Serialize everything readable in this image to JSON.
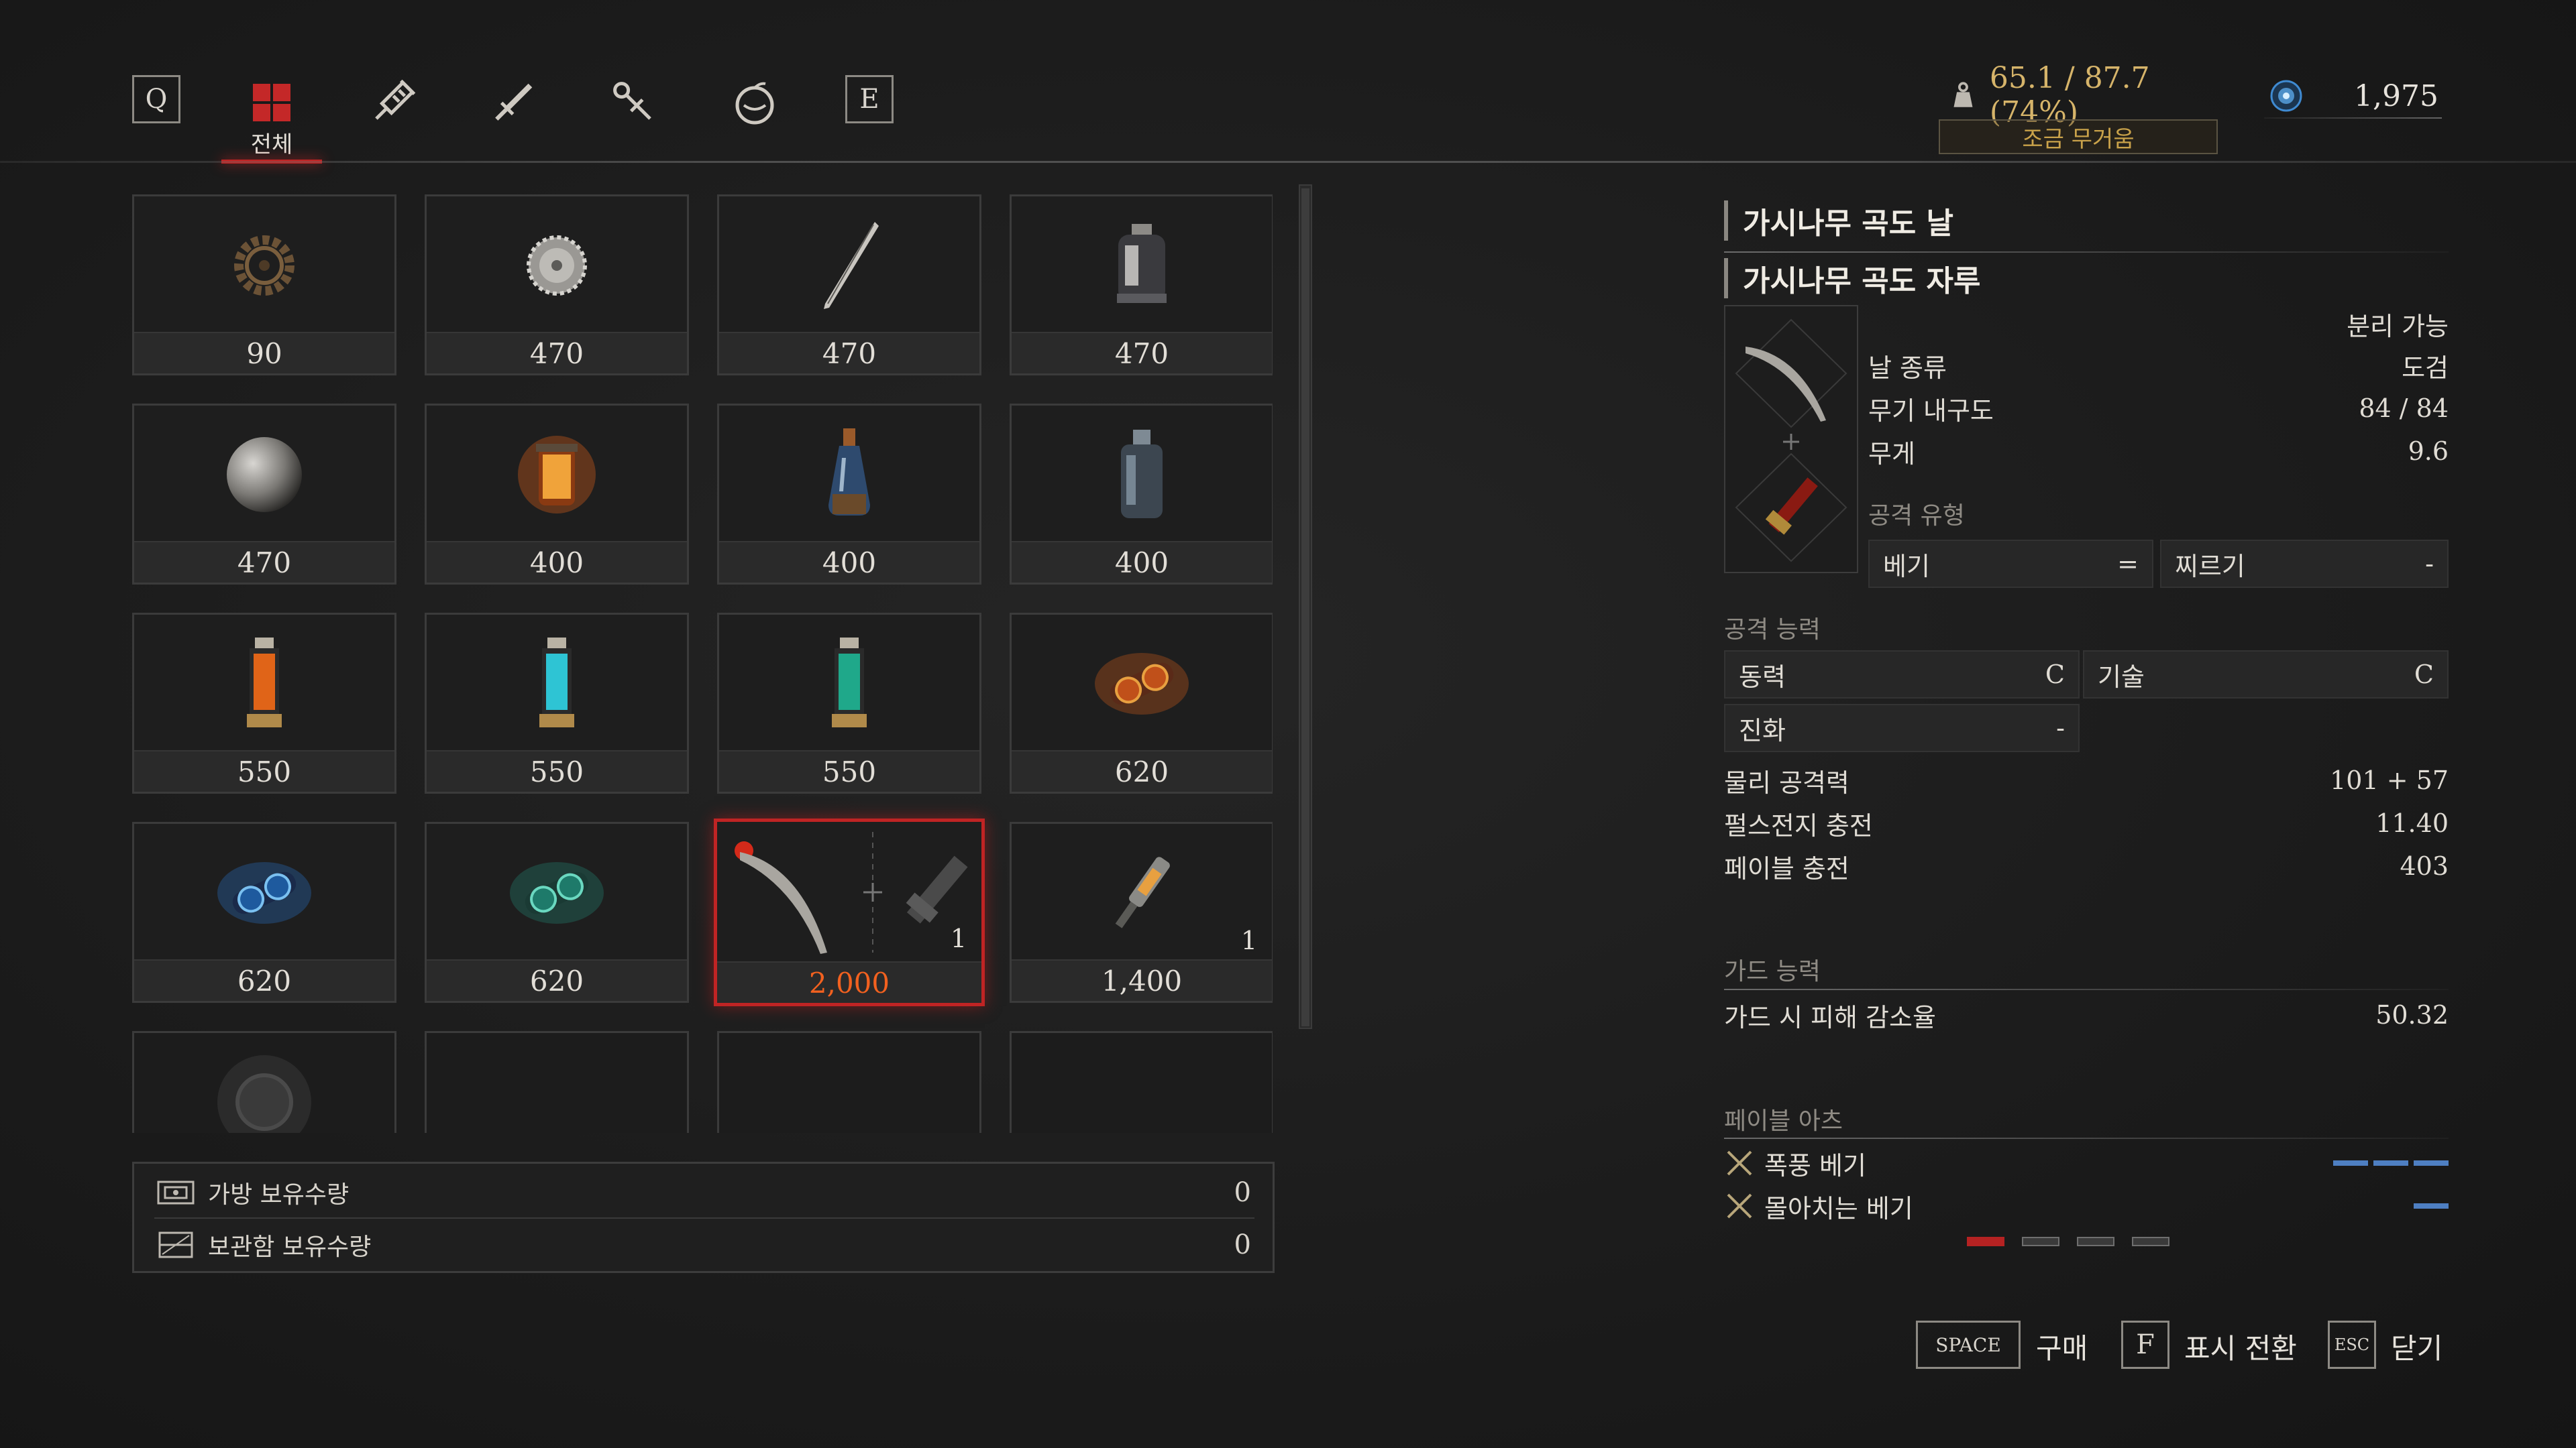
{
  "top_tabs": {
    "prev_key": "Q",
    "next_key": "E",
    "active_label": "전체",
    "icons": [
      "grid-icon",
      "syringe-icon",
      "dagger-icon",
      "wrench-icon",
      "orb-icon"
    ]
  },
  "weight": {
    "value": "65.1 / 87.7 (74%)",
    "status": "조금 무거움"
  },
  "currency": {
    "amount": "1,975"
  },
  "items": [
    {
      "price": "90",
      "icon": "gear-icon"
    },
    {
      "price": "470",
      "icon": "saw-blade-icon"
    },
    {
      "price": "470",
      "icon": "needle-icon"
    },
    {
      "price": "470",
      "icon": "canister-icon"
    },
    {
      "price": "470",
      "icon": "metal-sphere-icon"
    },
    {
      "price": "400",
      "icon": "fire-jar-icon"
    },
    {
      "price": "400",
      "icon": "flask-icon"
    },
    {
      "price": "400",
      "icon": "bottle-icon"
    },
    {
      "price": "550",
      "icon": "orange-cell-icon"
    },
    {
      "price": "550",
      "icon": "cyan-cell-icon"
    },
    {
      "price": "550",
      "icon": "green-cell-icon"
    },
    {
      "price": "620",
      "icon": "fire-cartridge-icon"
    },
    {
      "price": "620",
      "icon": "electric-cartridge-icon"
    },
    {
      "price": "620",
      "icon": "acid-cartridge-icon"
    },
    {
      "price": "2,000",
      "icon": "sickle-blade-icon",
      "qty": "1"
    },
    {
      "price": "1,400",
      "icon": "vial-tool-icon",
      "qty": "1"
    }
  ],
  "counts": {
    "bag_label": "가방 보유수량",
    "bag_value": "0",
    "storage_label": "보관함 보유수량",
    "storage_value": "0"
  },
  "detail": {
    "blade_name": "가시나무 곡도 날",
    "handle_name": "가시나무 곡도 자루",
    "separable": "분리 가능",
    "blade_type_label": "날 종류",
    "blade_type_value": "도검",
    "durability_label": "무기 내구도",
    "durability_value": "84 / 84",
    "weight_label": "무게",
    "weight_value": "9.6",
    "attack_type_label": "공격 유형",
    "attack_type_1": "베기",
    "attack_type_equals": "=",
    "attack_type_2": "찌르기",
    "attack_type_2_value": "-",
    "attack_ability_label": "공격 능력",
    "motivity_label": "동력",
    "motivity_value": "C",
    "technique_label": "기술",
    "technique_value": "C",
    "advance_label": "진화",
    "advance_value": "-",
    "phys_attack_label": "물리 공격력",
    "phys_attack_value": "101 + 57",
    "pulse_label": "펄스전지 충전",
    "pulse_value": "11.40",
    "fable_label": "페이블 충전",
    "fable_value": "403",
    "guard_label": "가드 능력",
    "guard_reduction_label": "가드 시 피해 감소율",
    "guard_reduction_value": "50.32",
    "fable_arts_label": "페이블 아츠",
    "arts": [
      {
        "name": "폭풍 베기",
        "pips": 3
      },
      {
        "name": "몰아치는 베기",
        "pips": 1
      }
    ],
    "page_count": 4,
    "page_active": 0
  },
  "footer": {
    "space_key": "SPACE",
    "buy_label": "구매",
    "f_key": "F",
    "toggle_label": "표시 전환",
    "esc_key": "ESC",
    "close_label": "닫기"
  },
  "colors": {
    "accent_red": "#c02424",
    "price_selected": "#f2611f",
    "weight_gold": "#d6b46a",
    "pip_blue": "#4e7fc2"
  }
}
